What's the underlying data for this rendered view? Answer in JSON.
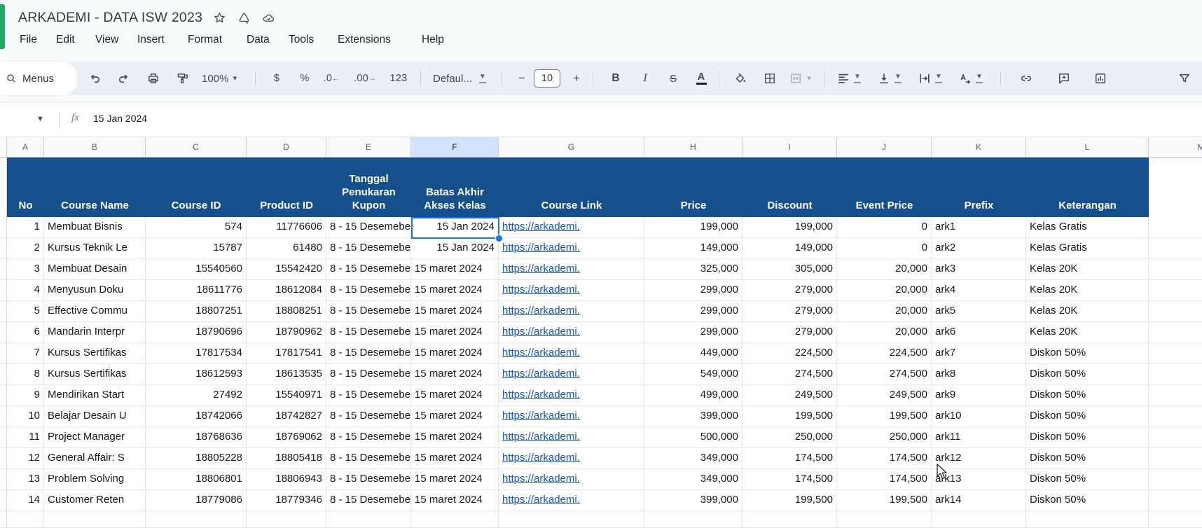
{
  "titlebar": {
    "title": "ARKADEMI - DATA ISW 2023"
  },
  "menubar": {
    "items": [
      "File",
      "Edit",
      "View",
      "Insert",
      "Format",
      "Data",
      "Tools",
      "Extensions",
      "Help"
    ]
  },
  "toolbar": {
    "menus_label": "Menus",
    "zoom_value": "100%",
    "currency_label": "$",
    "percent_label": "%",
    "decimal_decrease_label": ".0",
    "decimal_increase_label": ".00",
    "more_formats_label": "123",
    "font_name": "Defaul...",
    "minus_label": "−",
    "font_size": "10",
    "plus_label": "+",
    "bold_label": "B",
    "italic_label": "I",
    "strikethrough_label": "S",
    "text_color_label": "A"
  },
  "formula_bar": {
    "fx_label": "fx",
    "value": "15 Jan 2024"
  },
  "sheet": {
    "column_letters": [
      "A",
      "B",
      "C",
      "D",
      "E",
      "F",
      "G",
      "H",
      "I",
      "J",
      "K",
      "L",
      "M"
    ],
    "selected_column_letter": "F",
    "selected_cell_value": "15 Jan 2024",
    "header_labels": [
      "No",
      "Course Name",
      "Course ID",
      "Product ID",
      "Tanggal\nPenukaran\nKupon",
      "Batas Akhir\nAkses Kelas",
      "Course Link",
      "Price",
      "Discount",
      "Event Price",
      "Prefix",
      "Keterangan"
    ],
    "rows": [
      {
        "no": "1",
        "course_name": "Membuat Bisnis",
        "course_id": "574",
        "product_id": "11776606",
        "tanggal": "8 - 15 Desemebe",
        "batas": "15 Jan 2024",
        "link": "https://arkademi.",
        "price": "199,000",
        "discount": "199,000",
        "event_price": "0",
        "prefix": "ark1",
        "keterangan": "Kelas Gratis"
      },
      {
        "no": "2",
        "course_name": "Kursus Teknik Le",
        "course_id": "15787",
        "product_id": "61480",
        "tanggal": "8 - 15 Desemebe",
        "batas": "15 Jan 2024",
        "link": "https://arkademi.",
        "price": "149,000",
        "discount": "149,000",
        "event_price": "0",
        "prefix": "ark2",
        "keterangan": "Kelas Gratis"
      },
      {
        "no": "3",
        "course_name": "Membuat Desain",
        "course_id": "15540560",
        "product_id": "15542420",
        "tanggal": "8 - 15 Desemebe",
        "batas": "15 maret 2024",
        "link": "https://arkademi.",
        "price": "325,000",
        "discount": "305,000",
        "event_price": "20,000",
        "prefix": "ark3",
        "keterangan": "Kelas 20K"
      },
      {
        "no": "4",
        "course_name": "Menyusun Doku",
        "course_id": "18611776",
        "product_id": "18612084",
        "tanggal": "8 - 15 Desemebe",
        "batas": "15 maret 2024",
        "link": "https://arkademi.",
        "price": "299,000",
        "discount": "279,000",
        "event_price": "20,000",
        "prefix": "ark4",
        "keterangan": "Kelas 20K"
      },
      {
        "no": "5",
        "course_name": "Effective Commu",
        "course_id": "18807251",
        "product_id": "18808251",
        "tanggal": "8 - 15 Desemebe",
        "batas": "15 maret 2024",
        "link": "https://arkademi.",
        "price": "299,000",
        "discount": "279,000",
        "event_price": "20,000",
        "prefix": "ark5",
        "keterangan": "Kelas 20K"
      },
      {
        "no": "6",
        "course_name": "Mandarin Interpr",
        "course_id": "18790696",
        "product_id": "18790962",
        "tanggal": "8 - 15 Desemebe",
        "batas": "15 maret 2024",
        "link": "https://arkademi.",
        "price": "299,000",
        "discount": "279,000",
        "event_price": "20,000",
        "prefix": "ark6",
        "keterangan": "Kelas 20K"
      },
      {
        "no": "7",
        "course_name": "Kursus Sertifikas",
        "course_id": "17817534",
        "product_id": "17817541",
        "tanggal": "8 - 15 Desemebe",
        "batas": "15 maret 2024",
        "link": "https://arkademi.",
        "price": "449,000",
        "discount": "224,500",
        "event_price": "224,500",
        "prefix": "ark7",
        "keterangan": "Diskon 50%"
      },
      {
        "no": "8",
        "course_name": "Kursus Sertifikas",
        "course_id": "18612593",
        "product_id": "18613535",
        "tanggal": "8 - 15 Desemebe",
        "batas": "15 maret 2024",
        "link": "https://arkademi.",
        "price": "549,000",
        "discount": "274,500",
        "event_price": "274,500",
        "prefix": "ark8",
        "keterangan": "Diskon 50%"
      },
      {
        "no": "9",
        "course_name": "Mendirikan Start",
        "course_id": "27492",
        "product_id": "15540971",
        "tanggal": "8 - 15 Desemebe",
        "batas": "15 maret 2024",
        "link": "https://arkademi.",
        "price": "499,000",
        "discount": "249,500",
        "event_price": "249,500",
        "prefix": "ark9",
        "keterangan": "Diskon 50%"
      },
      {
        "no": "10",
        "course_name": "Belajar Desain U",
        "course_id": "18742066",
        "product_id": "18742827",
        "tanggal": "8 - 15 Desemebe",
        "batas": "15 maret 2024",
        "link": "https://arkademi.",
        "price": "399,000",
        "discount": "199,500",
        "event_price": "199,500",
        "prefix": "ark10",
        "keterangan": "Diskon 50%"
      },
      {
        "no": "11",
        "course_name": "Project Manager",
        "course_id": "18768636",
        "product_id": "18769062",
        "tanggal": "8 - 15 Desemebe",
        "batas": "15 maret 2024",
        "link": "https://arkademi.",
        "price": "500,000",
        "discount": "250,000",
        "event_price": "250,000",
        "prefix": "ark11",
        "keterangan": "Diskon 50%"
      },
      {
        "no": "12",
        "course_name": "General Affair: S",
        "course_id": "18805228",
        "product_id": "18805418",
        "tanggal": "8 - 15 Desemebe",
        "batas": "15 maret 2024",
        "link": "https://arkademi.",
        "price": "349,000",
        "discount": "174,500",
        "event_price": "174,500",
        "prefix": "ark12",
        "keterangan": "Diskon 50%"
      },
      {
        "no": "13",
        "course_name": "Problem Solving",
        "course_id": "18806801",
        "product_id": "18806943",
        "tanggal": "8 - 15 Desemebe",
        "batas": "15 maret 2024",
        "link": "https://arkademi.",
        "price": "349,000",
        "discount": "174,500",
        "event_price": "174,500",
        "prefix": "ark13",
        "keterangan": "Diskon 50%"
      },
      {
        "no": "14",
        "course_name": "Customer Reten",
        "course_id": "18779086",
        "product_id": "18779346",
        "tanggal": "8 - 15 Desemebe",
        "batas": "15 maret 2024",
        "link": "https://arkademi.",
        "price": "399,000",
        "discount": "199,500",
        "event_price": "199,500",
        "prefix": "ark14",
        "keterangan": "Diskon 50%"
      }
    ]
  },
  "colors": {
    "table_header_blue": "#16508c",
    "selected_column_highlight": "#d3e3fd",
    "link_blue": "#1155cc",
    "selection_blue": "#1a73e8"
  }
}
